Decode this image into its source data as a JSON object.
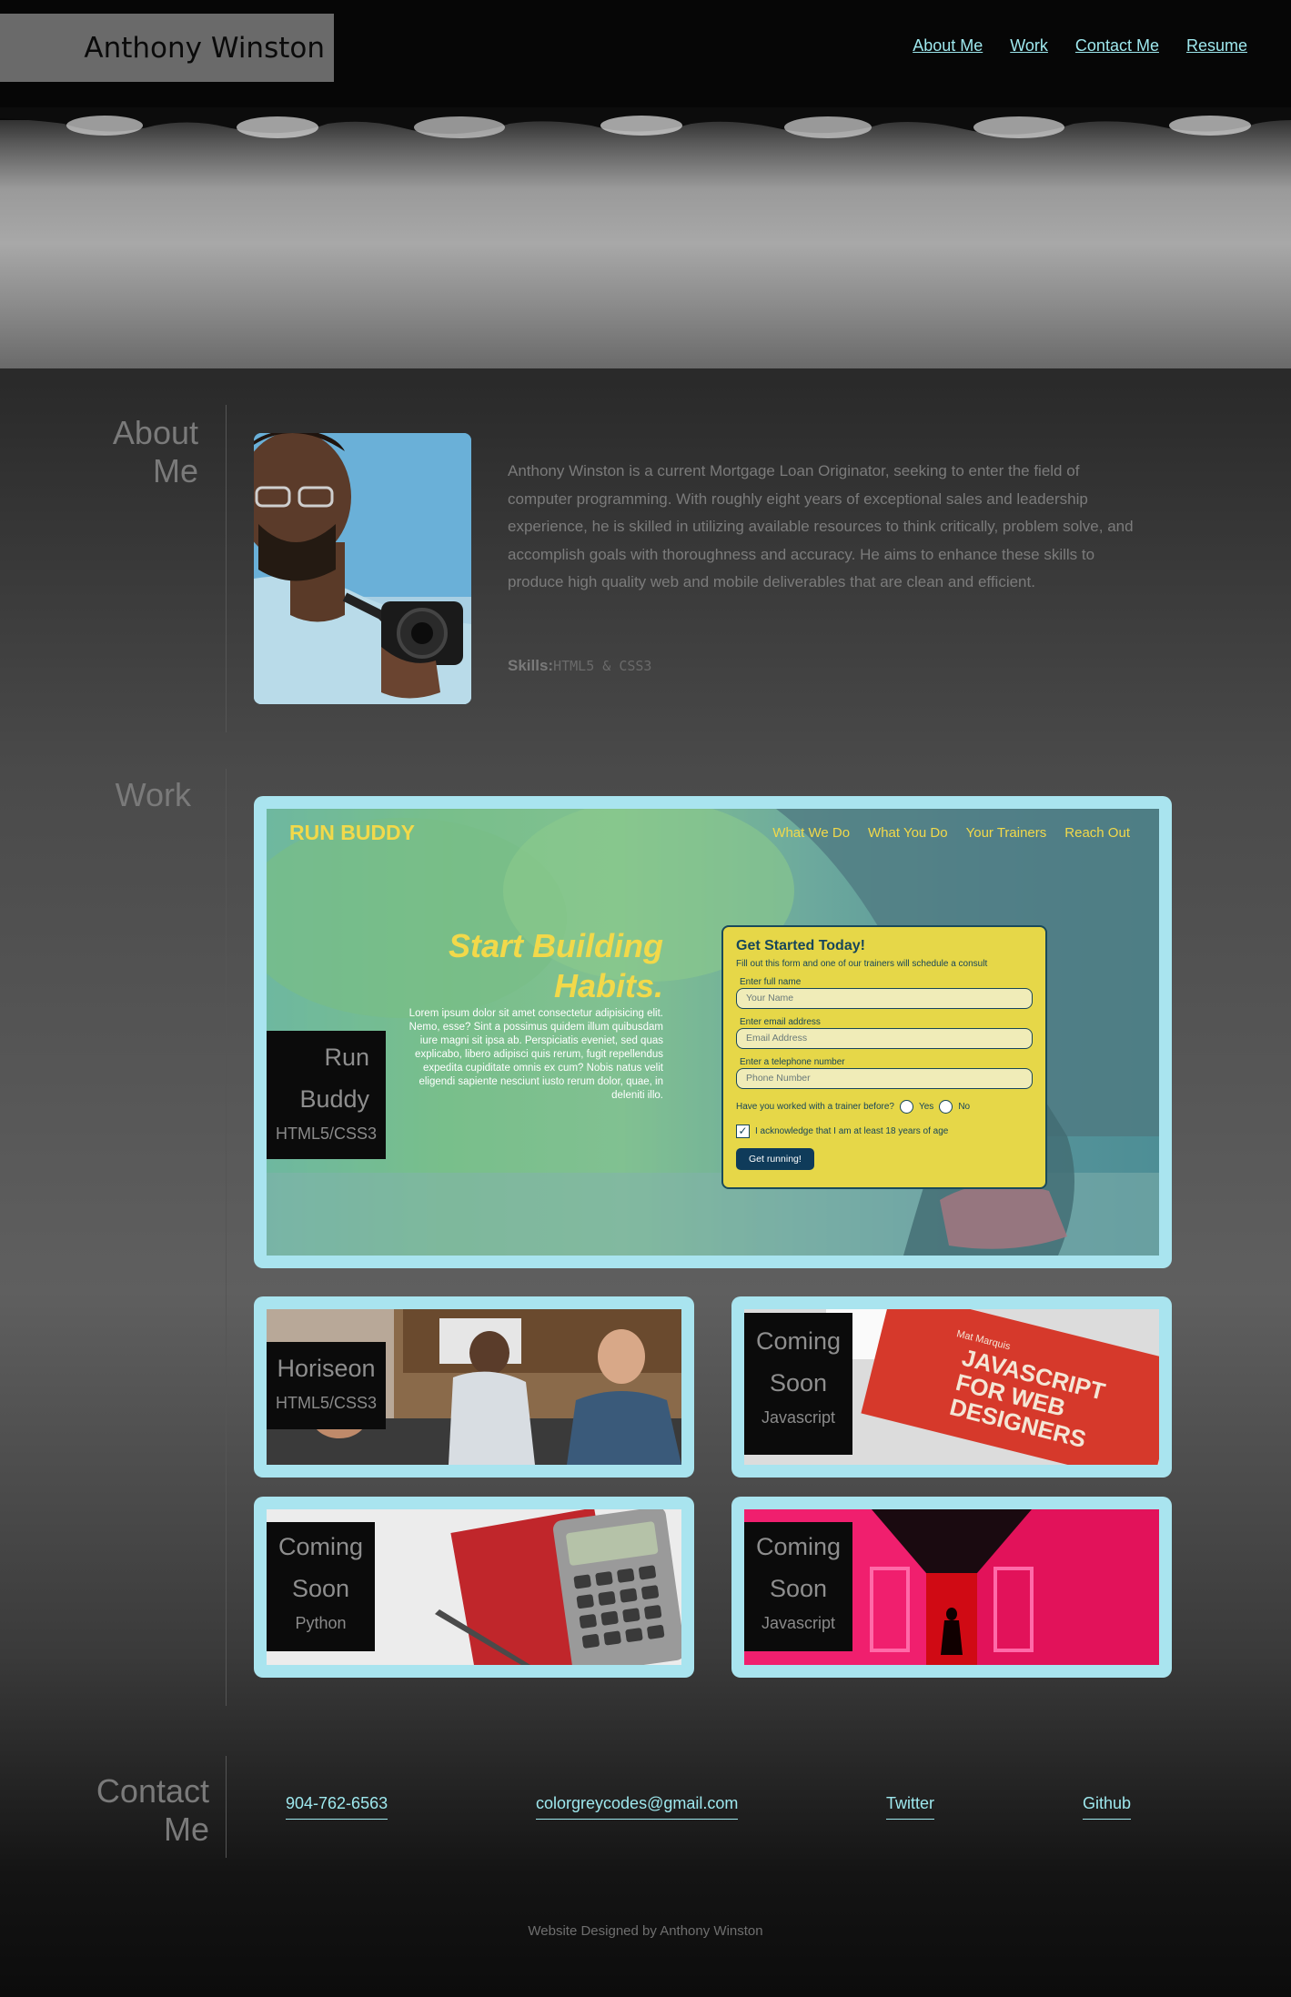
{
  "header": {
    "brand": "Anthony Winston",
    "nav": [
      "About Me",
      "Work",
      "Contact Me",
      "Resume"
    ]
  },
  "about": {
    "title_line1": "About",
    "title_line2": "Me",
    "bio": "Anthony Winston is a current Mortgage Loan Originator, seeking to enter the field of computer programming. With roughly eight years of exceptional sales and leadership experience, he is skilled in utilizing available resources to think critically, problem solve, and accomplish goals with thoroughness and accuracy. He aims to enhance these skills to produce high quality web and mobile deliverables that are clean and efficient.",
    "skills_label": "Skills:",
    "skills_value": "HTML5 & CSS3"
  },
  "work": {
    "title": "Work",
    "featured": {
      "name_line1": "Run",
      "name_line2": "Buddy",
      "tech": "HTML5/CSS3",
      "preview": {
        "logo": "RUN BUDDY",
        "nav": [
          "What We Do",
          "What You Do",
          "Your Trainers",
          "Reach Out"
        ],
        "headline_line1": "Start Building",
        "headline_line2": "Habits.",
        "lorem": "Lorem ipsum dolor sit amet consectetur adipisicing elit. Nemo, esse? Sint a possimus quidem illum quibusdam iure magni sit ipsa ab. Perspiciatis eveniet, sed quas explicabo, libero adipisci quis rerum, fugit repellendus expedita cupiditate omnis ex cum? Nobis natus velit eligendi sapiente nesciunt iusto rerum dolor, quae, in deleniti illo.",
        "form_title": "Get Started Today!",
        "form_sub": "Fill out this form and one of our trainers will schedule a consult",
        "label_name": "Enter full name",
        "ph_name": "Your Name",
        "label_email": "Enter email address",
        "ph_email": "Email Address",
        "label_phone": "Enter a telephone number",
        "ph_phone": "Phone Number",
        "question": "Have you worked with a trainer before?",
        "yes": "Yes",
        "no": "No",
        "acknowledge": "I acknowledge that I am at least 18 years of age",
        "button": "Get running!"
      }
    },
    "projects": [
      {
        "name_line1": "Horiseon",
        "name_line2": "",
        "tech": "HTML5/CSS3"
      },
      {
        "name_line1": "Coming",
        "name_line2": "Soon",
        "tech": "Javascript",
        "book_title": "JAVASCRIPT FOR WEB DESIGNERS",
        "book_author": "Mat Marquis"
      },
      {
        "name_line1": "Coming",
        "name_line2": "Soon",
        "tech": "Python"
      },
      {
        "name_line1": "Coming",
        "name_line2": "Soon",
        "tech": "Javascript"
      }
    ]
  },
  "contact": {
    "title_line1": "Contact",
    "title_line2": "Me",
    "phone": "904-762-6563",
    "email": "colorgreycodes@gmail.com",
    "twitter": "Twitter",
    "github": "Github"
  },
  "footer": "Website Designed by Anthony Winston",
  "colors": {
    "accent": "#9ee8ee",
    "card_frame": "#a9e4ef",
    "runbuddy_yellow": "#f2d94a"
  }
}
